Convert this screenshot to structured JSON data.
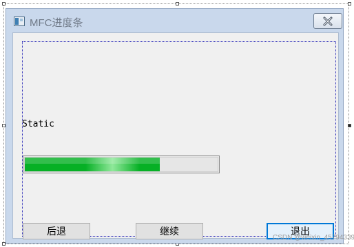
{
  "window": {
    "title": "MFC进度条",
    "close_icon": "close-x-icon",
    "app_icon": "dialog-app-icon"
  },
  "content": {
    "static_label": "Static",
    "progress": {
      "value_fraction": 0.7,
      "fill_color": "#06b025"
    }
  },
  "buttons": {
    "back_label": "后退",
    "continue_label": "继续",
    "exit_label": "退出",
    "focus_color": "#0078d7"
  },
  "watermark": {
    "text": "CSDN @weixin_45794339"
  }
}
